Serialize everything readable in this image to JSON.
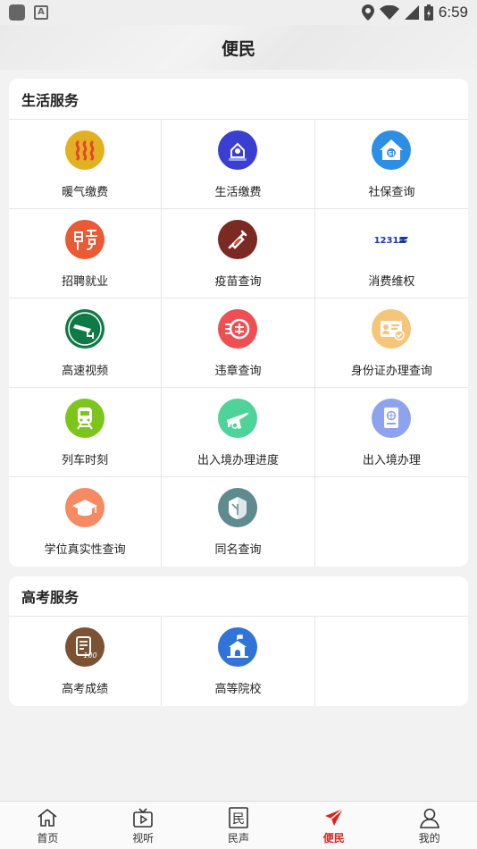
{
  "status_bar": {
    "time": "6:59"
  },
  "header": {
    "title": "便民"
  },
  "life_services": {
    "title": "生活服务",
    "items": [
      {
        "label": "暖气缴费",
        "icon": "heating-icon",
        "color": "#e2b122"
      },
      {
        "label": "生活缴费",
        "icon": "life-payment-icon",
        "color": "#3b3fd1"
      },
      {
        "label": "社保查询",
        "icon": "social-security-icon",
        "color": "#2d8ee6"
      },
      {
        "label": "招聘就业",
        "icon": "recruitment-icon",
        "color": "#ea5a34"
      },
      {
        "label": "疫苗查询",
        "icon": "vaccine-icon",
        "color": "#7a2a22"
      },
      {
        "label": "消费维权",
        "icon": "12315-icon",
        "color": "#1a3b9a",
        "icon_text": "12315"
      },
      {
        "label": "高速视频",
        "icon": "highway-camera-icon",
        "color": "#0f7a45"
      },
      {
        "label": "违章查询",
        "icon": "violation-icon",
        "color": "#ef4f52"
      },
      {
        "label": "身份证办理查询",
        "icon": "id-card-icon",
        "color": "#f5c57a"
      },
      {
        "label": "列车时刻",
        "icon": "train-icon",
        "color": "#7cc61b"
      },
      {
        "label": "出入境办理进度",
        "icon": "plane-icon",
        "color": "#4fd39a"
      },
      {
        "label": "出入境办理",
        "icon": "passport-icon",
        "color": "#8ea3ee"
      },
      {
        "label": "学位真实性查询",
        "icon": "graduation-cap-icon",
        "color": "#f58a63"
      },
      {
        "label": "同名查询",
        "icon": "same-name-icon",
        "color": "#5f8a8e"
      }
    ]
  },
  "gaokao_services": {
    "title": "高考服务",
    "items": [
      {
        "label": "高考成绩",
        "icon": "exam-score-icon",
        "color": "#7b5233",
        "icon_text": "100"
      },
      {
        "label": "高等院校",
        "icon": "university-icon",
        "color": "#2f74d6"
      }
    ]
  },
  "tabbar": {
    "items": [
      {
        "label": "首页",
        "icon": "home-icon"
      },
      {
        "label": "视听",
        "icon": "tv-icon"
      },
      {
        "label": "民声",
        "icon": "minsheng-icon",
        "icon_text": "民"
      },
      {
        "label": "便民",
        "icon": "send-icon",
        "active": true,
        "color": "#d9251d"
      },
      {
        "label": "我的",
        "icon": "user-icon"
      }
    ]
  }
}
